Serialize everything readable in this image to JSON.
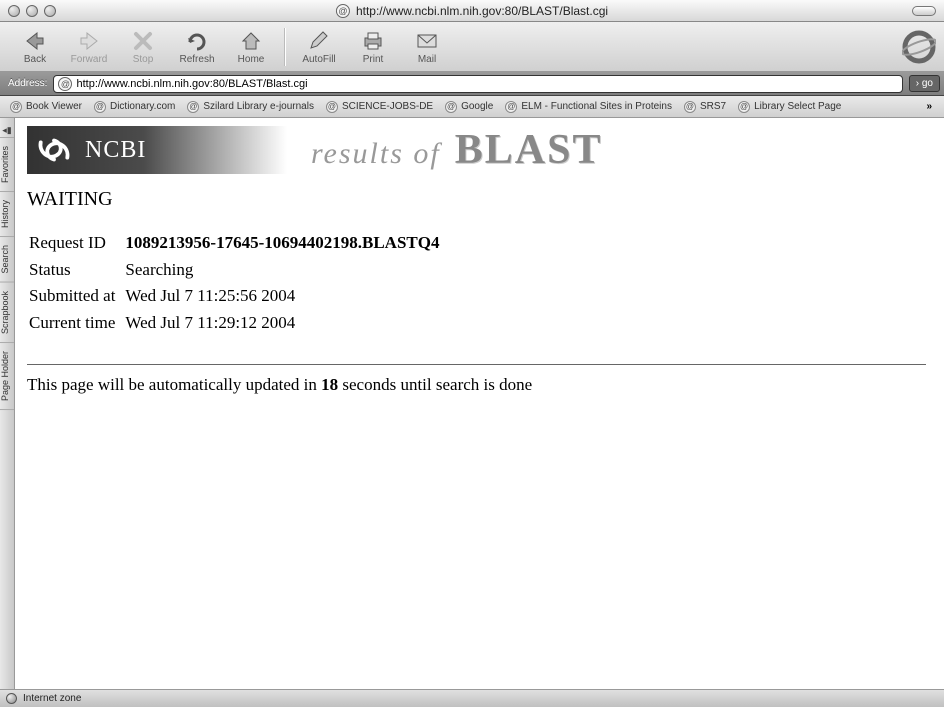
{
  "window": {
    "title_url": "http://www.ncbi.nlm.nih.gov:80/BLAST/Blast.cgi"
  },
  "toolbar": {
    "back": "Back",
    "forward": "Forward",
    "stop": "Stop",
    "refresh": "Refresh",
    "home": "Home",
    "autofill": "AutoFill",
    "print": "Print",
    "mail": "Mail"
  },
  "address": {
    "label": "Address:",
    "value": "http://www.ncbi.nlm.nih.gov:80/BLAST/Blast.cgi",
    "go_label": "go"
  },
  "bookmarks": [
    "Book Viewer",
    "Dictionary.com",
    "Szilard Library e-journals",
    "SCIENCE-JOBS-DE",
    "Google",
    "ELM - Functional Sites in Proteins",
    "SRS7",
    "Library Select Page"
  ],
  "sidebar": {
    "tabs": [
      "Favorites",
      "History",
      "Search",
      "Scrapbook",
      "Page Holder"
    ]
  },
  "page": {
    "ncbi_label": "NCBI",
    "results_of": "results of",
    "blast": "BLAST",
    "waiting": "WAITING",
    "rows": {
      "request_id_label": "Request ID",
      "request_id_value": "1089213956-17645-10694402198.BLASTQ4",
      "status_label": "Status",
      "status_value": "Searching",
      "submitted_label": "Submitted at",
      "submitted_value": "Wed Jul 7 11:25:56 2004",
      "current_label": "Current time",
      "current_value": "Wed Jul 7 11:29:12 2004"
    },
    "auto_update_before": "This page will be automatically updated in ",
    "auto_update_seconds": "18",
    "auto_update_after": " seconds until search is done"
  },
  "status": {
    "zone": "Internet zone"
  }
}
